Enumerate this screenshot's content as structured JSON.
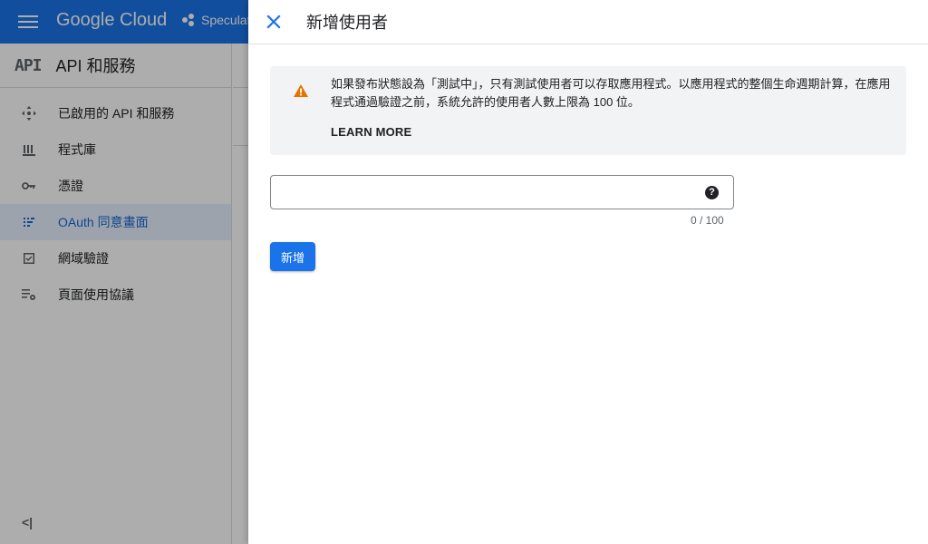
{
  "topbar": {
    "logo": "Google Cloud",
    "project": "Speculat"
  },
  "sidebar": {
    "badge": "API",
    "title": "API 和服務",
    "items": [
      {
        "label": "已啟用的 API 和服務",
        "icon": "hub-icon"
      },
      {
        "label": "程式庫",
        "icon": "library-icon"
      },
      {
        "label": "憑證",
        "icon": "key-icon"
      },
      {
        "label": "OAuth 同意畫面",
        "icon": "consent-icon",
        "active": true
      },
      {
        "label": "網域驗證",
        "icon": "checkbox-icon"
      },
      {
        "label": "頁面使用協議",
        "icon": "settings-list-icon"
      }
    ],
    "collapse": "<|"
  },
  "panel": {
    "title": "新增使用者",
    "notice": {
      "text": "如果發布狀態設為「測試中」，只有測試使用者可以存取應用程式。以應用程式的整個生命週期計算，在應用程式通過驗證之前，系統允許的使用者人數上限為 100 位。",
      "link": "LEARN MORE"
    },
    "input": {
      "value": "",
      "placeholder": "",
      "counter": "0 / 100"
    },
    "add_button": "新增"
  },
  "colors": {
    "brand": "#1a73e8",
    "warning": "#e37400",
    "active_bg": "#e8f0fe"
  }
}
